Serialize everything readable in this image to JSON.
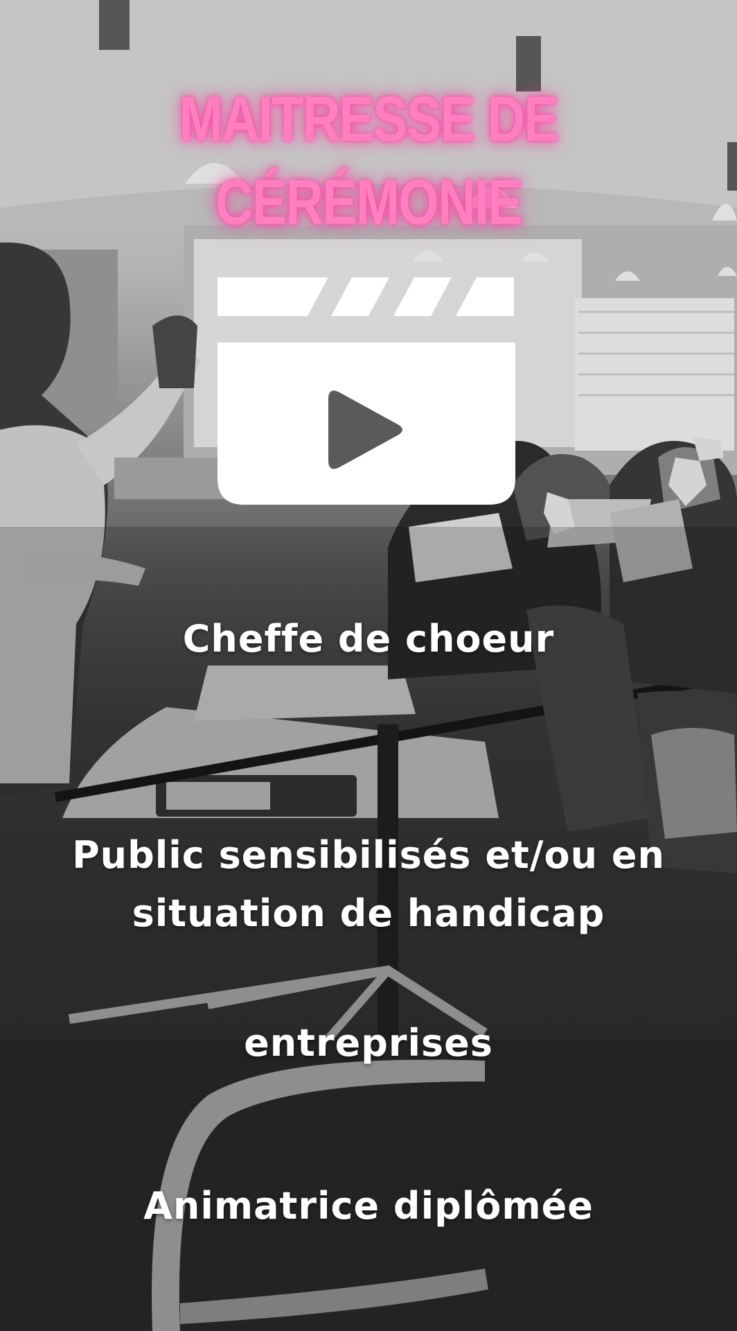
{
  "title": "MAITRESSE DE CÉRÉMONIE",
  "icon": "clapperboard-play-icon",
  "lines": [
    {
      "text": "Cheffe de choeur"
    },
    {
      "text_line1": "Public sensibilisés et/ou en",
      "text_line2": "situation de handicap"
    },
    {
      "text": "entreprises"
    },
    {
      "text": "Animatrice diplômée"
    }
  ],
  "colors": {
    "title": "#ff7fbf",
    "title_glow": "#ff3ca0",
    "text": "#ffffff"
  }
}
